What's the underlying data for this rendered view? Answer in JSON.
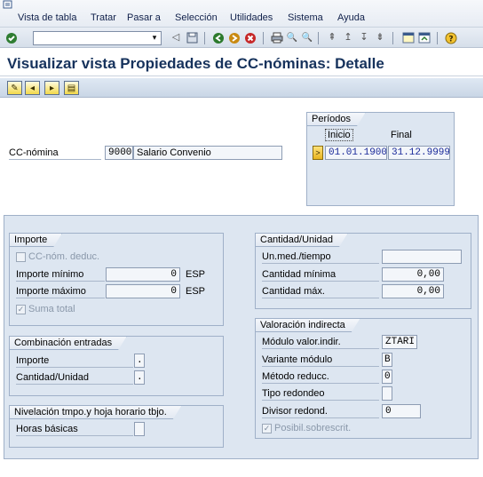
{
  "menu": {
    "items": [
      "Vista de tabla",
      "Tratar",
      "Pasar a",
      "Selección",
      "Utilidades",
      "Sistema",
      "Ayuda"
    ]
  },
  "toolbar": {
    "command_value": "",
    "icons": [
      "enter-icon",
      "command-dropdown-icon",
      "back-icon",
      "save-icon",
      "back-green-icon",
      "exit-icon",
      "cancel-icon",
      "print-icon",
      "find-icon",
      "find-next-icon",
      "first-page-icon",
      "previous-page-icon",
      "next-page-icon",
      "last-page-icon",
      "create-session-icon",
      "shortcut-icon",
      "help-icon"
    ]
  },
  "title": "Visualizar vista Propiedades de CC-nóminas: Detalle",
  "app_toolbar": {
    "icons": [
      "display-change-icon",
      "previous-entry-icon",
      "next-entry-icon",
      "other-entry-icon"
    ]
  },
  "header": {
    "cc_label": "CC-nómina",
    "cc_code": "9000",
    "cc_text": "Salario Convenio",
    "periods": {
      "title": "Períodos",
      "start_label": "Inicio",
      "end_label": "Final",
      "start": "01.01.1900",
      "end": "31.12.9999",
      "select_glyph": ">"
    }
  },
  "importe": {
    "title": "Importe",
    "deduc_label": "CC-nóm. deduc.",
    "min_label": "Importe mínimo",
    "min_value": "0",
    "min_unit": "ESP",
    "max_label": "Importe máximo",
    "max_value": "0",
    "max_unit": "ESP",
    "suma_label": "Suma total",
    "suma_checked": true
  },
  "combinacion": {
    "title": "Combinación entradas",
    "importe_label": "Importe",
    "importe_value": ".",
    "cantidad_label": "Cantidad/Unidad",
    "cantidad_value": "."
  },
  "nivelacion": {
    "title": "Nivelación tmpo.y hoja horario tbjo.",
    "horas_label": "Horas básicas",
    "horas_value": ""
  },
  "cantidad": {
    "title": "Cantidad/Unidad",
    "unmed_label": "Un.med./tiempo",
    "unmed_value": "",
    "min_label": "Cantidad mínima",
    "min_value": "0,00",
    "max_label": "Cantidad máx.",
    "max_value": "0,00"
  },
  "valoracion": {
    "title": "Valoración indirecta",
    "modulo_label": "Módulo valor.indir.",
    "modulo_value": "ZTARI",
    "variante_label": "Variante módulo",
    "variante_value": "B",
    "metodo_label": "Método reducc.",
    "metodo_value": "0",
    "redondeo_label": "Tipo redondeo",
    "redondeo_value": "",
    "divisor_label": "Divisor redond.",
    "divisor_value": "0",
    "posibil_label": "Posibil.sobrescrit.",
    "posibil_checked": true
  },
  "colors": {
    "title": "#16325c",
    "panel": "#dde6f1",
    "border": "#9fb0c8"
  }
}
